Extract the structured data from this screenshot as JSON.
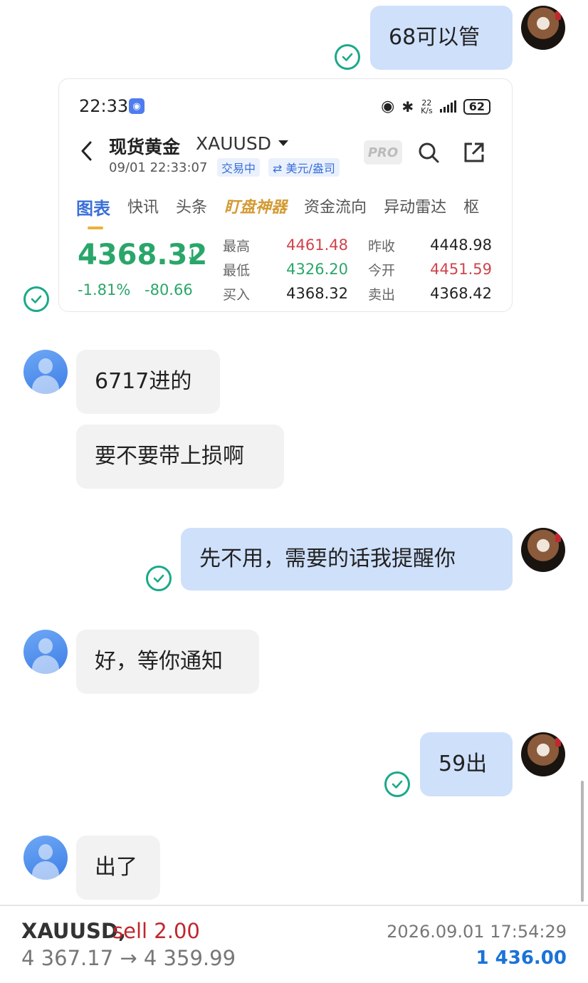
{
  "messages": {
    "m1": "68可以管",
    "m2": "6717进的",
    "m3": "要不要带上损啊",
    "m4": "先不用，需要的话我提醒你",
    "m5": "好，等你通知",
    "m6": "59出",
    "m7": "出了"
  },
  "quote_card": {
    "status_time": "22:33",
    "net_speed_top": "22",
    "net_speed_unit": "K/s",
    "battery": "62",
    "asset_name": "现货黄金",
    "asset_code": "XAUUSD",
    "datetime": "09/01 22:33:07",
    "tag_trading": "交易中",
    "tag_unit": "⇄ 美元/盎司",
    "pro_label": "PRO",
    "tabs": [
      "图表",
      "快讯",
      "头条",
      "盯盘神器",
      "资金流向",
      "异动雷达",
      "枢"
    ],
    "price": "4368.32",
    "change_pct": "-1.81%",
    "change_abs": "-80.66",
    "stats": {
      "high_label": "最高",
      "high": "4461.48",
      "low_label": "最低",
      "low": "4326.20",
      "bid_label": "买入",
      "bid": "4368.32",
      "prev_close_label": "昨收",
      "prev_close": "4448.98",
      "open_label": "今开",
      "open": "4451.59",
      "ask_label": "卖出",
      "ask": "4368.42"
    },
    "colors": {
      "up": "#d1434b",
      "down": "#2aa66a",
      "accent": "#3a6fd8"
    }
  },
  "trade_bar": {
    "symbol": "XAUUSD,",
    "side": "sell 2.00",
    "prices": "4 367.17 → 4 359.99",
    "time": "2026.09.01 17:54:29",
    "profit": "1 436.00"
  }
}
